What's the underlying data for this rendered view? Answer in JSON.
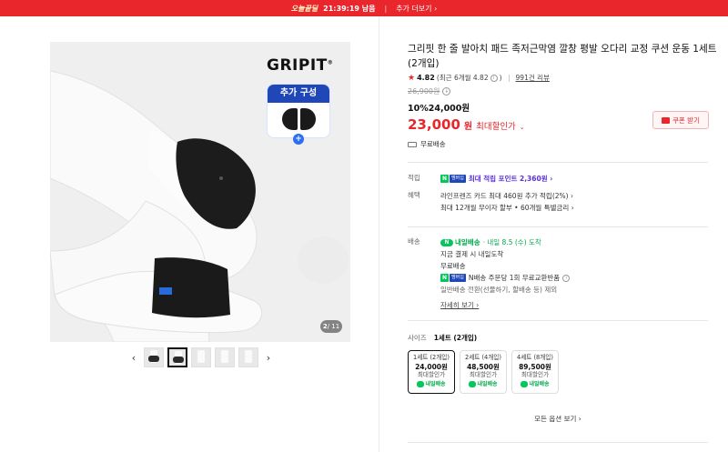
{
  "topbar": {
    "promo": "오늘끝딜",
    "timer": "21:39:19 남음",
    "more": "추가 더보기 ›"
  },
  "gallery": {
    "brand": "GRIPIT",
    "addon_label": "추가 구성",
    "page_current": "2",
    "page_total": "/ 11",
    "prev_icon": "‹",
    "next_icon": "›"
  },
  "product": {
    "title": "그리핏 한 줄 발아치 패드 족저근막염 깔창 평발 오다리 교정 쿠션 운동 1세트 (2개입)",
    "rating": "4.82",
    "rating_recent": "(최근 6개월 4.82",
    "rating_recent_end": ")",
    "reviews": "991건 리뷰",
    "original_price": "26,900원",
    "discount": "10%24,000원",
    "final_price": "23,000",
    "final_won": "원",
    "final_label": "최대할인가",
    "coupon_label": "쿠폰 받기",
    "shipping": "무료배송"
  },
  "benefits": {
    "points_label": "적립",
    "points_text": "최대 적립 포인트 2,360원 ›",
    "card_label": "혜택",
    "card_line1": "라인프렌즈 카드 최대 460원 추가 적립(2%) ›",
    "card_line2": "최대 12개월 무이자 할부 • 60개월 특별금리 ›"
  },
  "delivery": {
    "label": "배송",
    "tag": "내일배송",
    "arrive": "· 내일 8.5 (수) 도착",
    "line1": "지금 결제 시 내일도착",
    "line2": "무료배송",
    "line3": "N배송 주문당 1회 무료교환반품",
    "line4": "일반배송 전환(선물하기, 할배송 등) 제외",
    "more": "자세히 보기 ›"
  },
  "options": {
    "size_label": "사이즈",
    "size_value": "1세트 (2개입)",
    "items": [
      {
        "name": "1세트 (2개입)",
        "price": "24,000원",
        "sub": "최대할인가",
        "tag": "내일배송"
      },
      {
        "name": "2세트 (4개입)",
        "price": "48,500원",
        "sub": "최대할인가",
        "tag": "내일배송"
      },
      {
        "name": "4세트 (8개입)",
        "price": "89,500원",
        "sub": "최대할인가",
        "tag": "내일배송"
      }
    ],
    "all_options": "모든 옵션 보기 ›"
  }
}
